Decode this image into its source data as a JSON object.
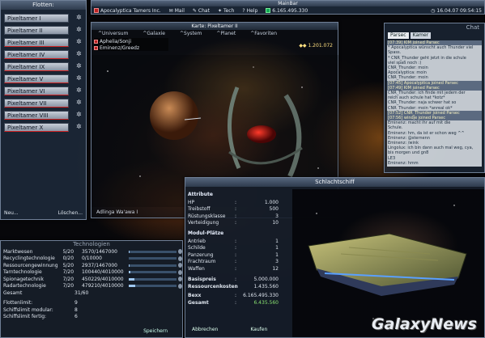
{
  "mainbar": {
    "title": "MainBar",
    "alliance": "Apocalyptica Tamers Inc.",
    "menu": [
      "Mail",
      "Chat",
      "Tech",
      "Help"
    ],
    "credits": "6.165.495.330",
    "date": "16.04.07 09:54:15"
  },
  "fleets": {
    "title": "Flotten:",
    "items": [
      "Pixeltamer I",
      "Pixeltamer II",
      "Pixeltamer III",
      "Pixeltamer IV",
      "Pixeltamer IX",
      "Pixeltamer V",
      "Pixeltamer VI",
      "Pixeltamer VII",
      "Pixeltamer VIII",
      "Pixeltamer X"
    ],
    "new_label": "Neu...",
    "delete_label": "Löschen..."
  },
  "map": {
    "title": "Karte: Pixeltamer II",
    "nav": [
      "^Universum",
      "^Galaxie",
      "^System",
      "^Planet",
      "^Favoriten"
    ],
    "list": [
      "Aphelia/Sonji",
      "Eminenz/Greedz"
    ],
    "resource": "1.201.072",
    "footer": "Adlinga Wa'awa I"
  },
  "chat": {
    "title": "Chat",
    "tabs": [
      "Parsec",
      "Kamer"
    ],
    "lines": [
      {
        "t": "[07:39] KIM joined Parsec",
        "sys": true
      },
      {
        "t": "* Apocalyptica wünscht auch Thunder viel",
        "sys": false
      },
      {
        "t": "Spass.",
        "sys": false
      },
      {
        "t": "* CNR_Thunder geht jetzt in die schule",
        "sys": false
      },
      {
        "t": "viel spaß noch :)",
        "sys": false
      },
      {
        "t": "CNR_Thunder: moin",
        "sys": false
      },
      {
        "t": "Apocalyptica: moin",
        "sys": false
      },
      {
        "t": "CNR_Thunder: moin",
        "sys": false
      },
      {
        "t": "[07:45] Apocalyptica joined Parsec",
        "sys": true
      },
      {
        "t": "[07:49] KIM joined Parsec",
        "sys": true
      },
      {
        "t": "CNR_Thunder: ich finde mit jedem der",
        "sys": false
      },
      {
        "t": "reich auch schule hat *kotz*",
        "sys": false
      },
      {
        "t": "CNR_Thunder: naja schwer hat so",
        "sys": false
      },
      {
        "t": "CNR_Thunder: moin *anreal ok*",
        "sys": false
      },
      {
        "t": "[07:52] CNR_Thunder joined Parsec",
        "sys": true
      },
      {
        "t": "[07:56] windje joined Parsec",
        "sys": true
      },
      {
        "t": "Eminenz: macht ihr auf mit die",
        "sys": false
      },
      {
        "t": "Schule.",
        "sys": false
      },
      {
        "t": "Eminenz: hm, da ist er schon weg ^^",
        "sys": false
      },
      {
        "t": "Eminenz: @sternenn",
        "sys": false
      },
      {
        "t": "Eminenz: /wink",
        "sys": false
      },
      {
        "t": "Lingolux: ich bin dann auch mal weg, cya,",
        "sys": false
      },
      {
        "t": "bis morgen und gn8",
        "sys": false
      },
      {
        "t": "LE3",
        "sys": false
      },
      {
        "t": "Eminenz: hmm",
        "sys": false
      }
    ]
  },
  "tech": {
    "title": "Technologien",
    "rows": [
      {
        "name": "Marktwesen",
        "level": "5/20",
        "value": "3570/1467000",
        "bar": 0.01
      },
      {
        "name": "Recyclingtechnologie",
        "level": "0/20",
        "value": "0/10000",
        "bar": 0.0
      },
      {
        "name": "Ressourcengewinnung",
        "level": "5/20",
        "value": "2937/1467000",
        "bar": 0.01
      },
      {
        "name": "Tarntechnologie",
        "level": "7/20",
        "value": "100440/4010000",
        "bar": 0.03
      },
      {
        "name": "Spionagetechnik",
        "level": "7/20",
        "value": "450229/4010000",
        "bar": 0.11
      },
      {
        "name": "Radartechnologie",
        "level": "7/20",
        "value": "479210/4010000",
        "bar": 0.12
      },
      {
        "name": "Gesamt",
        "level": "31/60",
        "value": "",
        "bar": null
      }
    ],
    "stats": [
      {
        "k": "Flottenlimit:",
        "v": "9"
      },
      {
        "k": "Schiffslimit modular:",
        "v": "8"
      },
      {
        "k": "Schiffslimit fertig:",
        "v": "6"
      }
    ],
    "save_label": "Speichern"
  },
  "ship": {
    "title": "Schlachtschiff",
    "attr_title": "Attribute",
    "attrs": [
      {
        "k": "HP",
        "v": "1.000"
      },
      {
        "k": "Treibstoff",
        "v": "500"
      },
      {
        "k": "Rüstungsklasse",
        "v": "3"
      },
      {
        "k": "Verteidigung",
        "v": "10"
      }
    ],
    "mod_title": "Modul-Plätze",
    "mods": [
      {
        "k": "Antrieb",
        "v": "1"
      },
      {
        "k": "Schilde",
        "v": "1"
      },
      {
        "k": "Panzerung",
        "v": "1"
      },
      {
        "k": "Frachtraum",
        "v": "3"
      },
      {
        "k": "Waffen",
        "v": "12"
      }
    ],
    "costs": [
      {
        "k": "Basispreis",
        "v": "5.000.000"
      },
      {
        "k": "Ressourcenkosten",
        "v": "1.435.560"
      }
    ],
    "totals": [
      {
        "k": "Bexx",
        "v": "6.165.495.330"
      },
      {
        "k": "Gesamt",
        "v": "6.435.560"
      }
    ],
    "cancel_label": "Abbrechen",
    "buy_label": "Kaufen"
  },
  "logo": "GalaxyNews"
}
